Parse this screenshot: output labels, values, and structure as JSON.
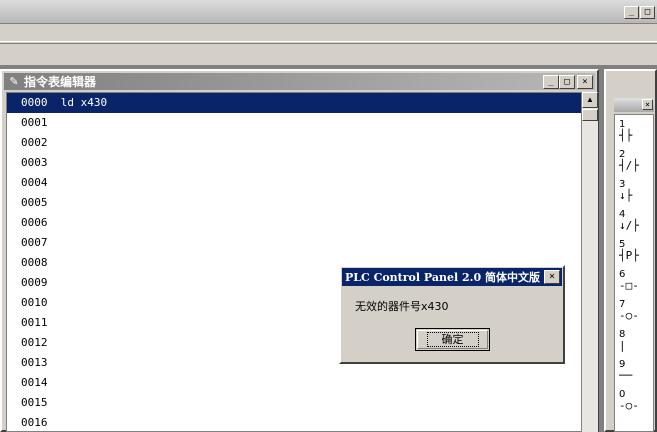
{
  "app": {
    "sys_buttons": [
      "_",
      "□"
    ]
  },
  "editor": {
    "title": "指令表编辑器",
    "window_buttons": [
      "_",
      "□",
      "×"
    ],
    "lines": [
      {
        "num": "0000",
        "code": "ld x430",
        "selected": true
      },
      {
        "num": "0001",
        "code": ""
      },
      {
        "num": "0002",
        "code": ""
      },
      {
        "num": "0003",
        "code": ""
      },
      {
        "num": "0004",
        "code": ""
      },
      {
        "num": "0005",
        "code": ""
      },
      {
        "num": "0006",
        "code": ""
      },
      {
        "num": "0007",
        "code": ""
      },
      {
        "num": "0008",
        "code": ""
      },
      {
        "num": "0009",
        "code": ""
      },
      {
        "num": "0010",
        "code": ""
      },
      {
        "num": "0011",
        "code": ""
      },
      {
        "num": "0012",
        "code": ""
      },
      {
        "num": "0013",
        "code": ""
      },
      {
        "num": "0014",
        "code": ""
      },
      {
        "num": "0015",
        "code": ""
      },
      {
        "num": "0016",
        "code": ""
      }
    ]
  },
  "palette": {
    "close": "×",
    "items": [
      {
        "num": "1",
        "symbol": "┤├"
      },
      {
        "num": "2",
        "symbol": "┤/├"
      },
      {
        "num": "3",
        "symbol": "↓├"
      },
      {
        "num": "4",
        "symbol": "↓/├"
      },
      {
        "num": "5",
        "symbol": "┤P├"
      },
      {
        "num": "6",
        "symbol": "-□-"
      },
      {
        "num": "7",
        "symbol": "-○-"
      },
      {
        "num": "8",
        "symbol": "|"
      },
      {
        "num": "9",
        "symbol": "──"
      },
      {
        "num": "0",
        "symbol": "-○-"
      }
    ]
  },
  "dialog": {
    "title": "PLC Control Panel 2.0 简体中文版",
    "close": "×",
    "message": "无效的器件号x430",
    "ok_label": "确定"
  }
}
